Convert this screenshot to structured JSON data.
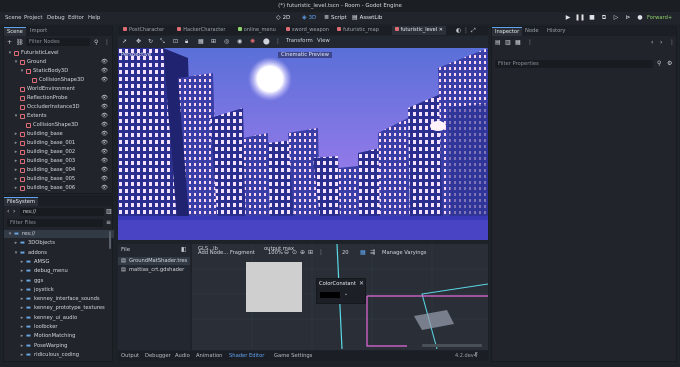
{
  "window": {
    "title": "(*) futuristic_level.tscn - Room - Godot Engine"
  },
  "menubar": {
    "menus": [
      "Scene",
      "Project",
      "Debug",
      "Editor",
      "Help"
    ],
    "workspaces": [
      {
        "icon": "2d-icon",
        "label": "2D"
      },
      {
        "icon": "3d-icon",
        "label": "3D"
      },
      {
        "icon": "script-icon",
        "label": "Script"
      },
      {
        "icon": "assetlib-icon",
        "label": "AssetLib"
      }
    ],
    "renderer": "Forward+"
  },
  "scene_dock": {
    "tabs": [
      "Scene",
      "Import"
    ],
    "filter_placeholder": "Filter Nodes",
    "nodes": [
      {
        "label": "FuturisticLevel",
        "depth": 0,
        "arrow": "▾",
        "color": "#e06c75",
        "eye": false,
        "sel": false
      },
      {
        "label": "Ground",
        "depth": 1,
        "arrow": "▾",
        "color": "#e06c75",
        "eye": true,
        "sel": false
      },
      {
        "label": "StaticBody3D",
        "depth": 2,
        "arrow": "▾",
        "color": "#e06c75",
        "eye": true,
        "sel": false
      },
      {
        "label": "CollisionShape3D",
        "depth": 3,
        "arrow": "",
        "color": "#e06c75",
        "eye": true,
        "sel": false
      },
      {
        "label": "WorldEnvironment",
        "depth": 1,
        "arrow": "",
        "color": "#e06c75",
        "eye": false,
        "sel": false
      },
      {
        "label": "ReflectionProbe",
        "depth": 1,
        "arrow": "",
        "color": "#e06c75",
        "eye": true,
        "sel": false
      },
      {
        "label": "OccluderInstance3D",
        "depth": 1,
        "arrow": "",
        "color": "#e06c75",
        "eye": true,
        "sel": false
      },
      {
        "label": "Extents",
        "depth": 1,
        "arrow": "▾",
        "color": "#e06c75",
        "eye": true,
        "sel": false
      },
      {
        "label": "CollisionShape3D",
        "depth": 2,
        "arrow": "",
        "color": "#e06c75",
        "eye": true,
        "sel": false
      },
      {
        "label": "building_base",
        "depth": 1,
        "arrow": "▸",
        "color": "#e06c75",
        "eye": true,
        "sel": false
      },
      {
        "label": "building_base_001",
        "depth": 1,
        "arrow": "▸",
        "color": "#e06c75",
        "eye": true,
        "sel": false
      },
      {
        "label": "building_base_002",
        "depth": 1,
        "arrow": "▸",
        "color": "#e06c75",
        "eye": true,
        "sel": false
      },
      {
        "label": "building_base_003",
        "depth": 1,
        "arrow": "▸",
        "color": "#e06c75",
        "eye": true,
        "sel": false
      },
      {
        "label": "building_base_004",
        "depth": 1,
        "arrow": "▸",
        "color": "#e06c75",
        "eye": true,
        "sel": false
      },
      {
        "label": "building_base_005",
        "depth": 1,
        "arrow": "▸",
        "color": "#e06c75",
        "eye": true,
        "sel": false
      },
      {
        "label": "building_base_006",
        "depth": 1,
        "arrow": "▸",
        "color": "#e06c75",
        "eye": true,
        "sel": false
      }
    ]
  },
  "filesystem": {
    "title": "FileSystem",
    "path": "res://",
    "filter_placeholder": "Filter Files",
    "items": [
      {
        "label": "res://",
        "depth": 0,
        "arrow": "▾",
        "sel": true
      },
      {
        "label": "3DObjects",
        "depth": 1,
        "arrow": "▸",
        "sel": false
      },
      {
        "label": "addons",
        "depth": 1,
        "arrow": "▾",
        "sel": false
      },
      {
        "label": "AMSG",
        "depth": 2,
        "arrow": "▸",
        "sel": false
      },
      {
        "label": "debug_menu",
        "depth": 2,
        "arrow": "▸",
        "sel": false
      },
      {
        "label": "ggs",
        "depth": 2,
        "arrow": "▸",
        "sel": false
      },
      {
        "label": "joystick",
        "depth": 2,
        "arrow": "▸",
        "sel": false
      },
      {
        "label": "kenney_interface_sounds",
        "depth": 2,
        "arrow": "▸",
        "sel": false
      },
      {
        "label": "kenney_prototype_textures",
        "depth": 2,
        "arrow": "▸",
        "sel": false
      },
      {
        "label": "kenney_ui_audio",
        "depth": 2,
        "arrow": "▸",
        "sel": false
      },
      {
        "label": "loolbcker",
        "depth": 2,
        "arrow": "▸",
        "sel": false
      },
      {
        "label": "MotionMatching",
        "depth": 2,
        "arrow": "▸",
        "sel": false
      },
      {
        "label": "PoseWarping",
        "depth": 2,
        "arrow": "▸",
        "sel": false
      },
      {
        "label": "ridiculous_coding",
        "depth": 2,
        "arrow": "▸",
        "sel": false
      }
    ]
  },
  "scene_tabs": [
    {
      "label": "PostCharacter",
      "color": "#e06c75",
      "on": false
    },
    {
      "label": "HackerCharacter",
      "color": "#e06c75",
      "on": false
    },
    {
      "label": "online_menu",
      "color": "#8fd16a",
      "on": false
    },
    {
      "label": "sword_weapon",
      "color": "#e06c75",
      "on": false
    },
    {
      "label": "futuristic_map",
      "color": "#e06c75",
      "on": false
    },
    {
      "label": "futuristic_level",
      "color": "#e06c75",
      "on": true
    }
  ],
  "viewport": {
    "perspective_label": "Perspective",
    "preview_label": "Cinematic Preview",
    "menus": [
      "Transform",
      "View"
    ]
  },
  "shader_editor": {
    "files_header": "File",
    "files": [
      {
        "label": "GroundMatShader.tres",
        "sel": true
      },
      {
        "label": "mattias_crt.gdshader",
        "sel": false
      }
    ],
    "graph_tabs": [
      "GLS...lb"
    ],
    "add_node": "Add Node...",
    "mode": "Fragment",
    "zoom": "100%",
    "snap": "20",
    "manage_varyings": "Manage Varyings",
    "output_label": "output max",
    "node_title": "ColorConstant",
    "node_color": "#000000"
  },
  "bottom_tabs": [
    {
      "label": "Output",
      "on": false
    },
    {
      "label": "Debugger",
      "on": false
    },
    {
      "label": "Audio",
      "on": false
    },
    {
      "label": "Animation",
      "on": false
    },
    {
      "label": "Shader Editor",
      "on": true
    },
    {
      "label": "Game Settings",
      "on": false
    }
  ],
  "version": "4.2.dev4",
  "inspector": {
    "tabs": [
      "Inspector",
      "Node",
      "History"
    ],
    "filter_placeholder": "Filter Properties"
  }
}
